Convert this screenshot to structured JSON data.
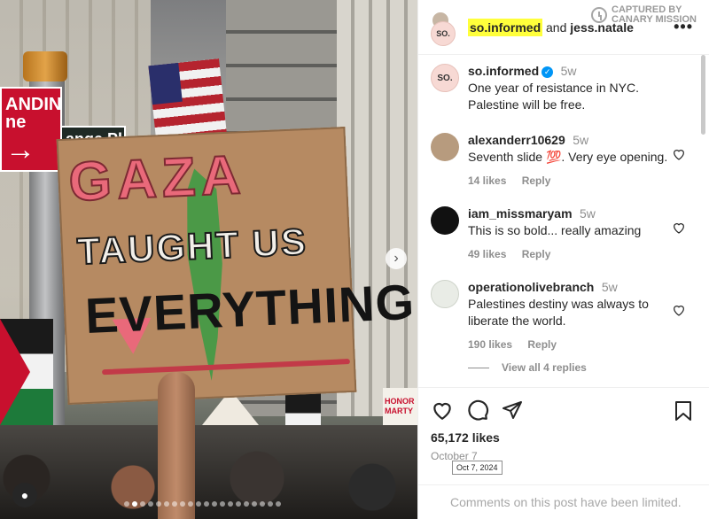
{
  "post": {
    "header": {
      "author": "so.informed",
      "joiner": "and",
      "collaborator": "jess.natale",
      "avatar_text": "SO."
    },
    "watermark": {
      "line1": "CAPTURED BY",
      "line2": "CANARY MISSION"
    },
    "photo": {
      "sign_red_text": "ANDING\nne",
      "sign_street_text": "ange Pl",
      "sign_line1": "GAZA",
      "sign_line2": "TAUGHT US",
      "sign_line3": "EVERYTHING",
      "right_sign_text": "HONOR\nMARTY\n\nOF PALES",
      "carousel_index": 1,
      "carousel_count": 20
    },
    "caption": {
      "username": "so.informed",
      "time": "5w",
      "verified": true,
      "text": "One year of resistance in NYC. Palestine will be free."
    },
    "comments": [
      {
        "username": "alexanderr10629",
        "time": "5w",
        "text": "Seventh slide 💯. Very eye opening.",
        "likes": "14 likes",
        "reply": "Reply",
        "avatar_color": "#b79b7e"
      },
      {
        "username": "iam_missmaryam",
        "time": "5w",
        "text": "This is so bold... really amazing",
        "likes": "49 likes",
        "reply": "Reply",
        "avatar_color": "#111111"
      },
      {
        "username": "operationolivebranch",
        "time": "5w",
        "text": "Palestines destiny was always to liberate the world.",
        "likes": "190 likes",
        "reply": "Reply",
        "avatar_color": "#e9ece6"
      }
    ],
    "view_replies": "View all 4 replies",
    "likes_count": "65,172 likes",
    "date": "October 7",
    "date_tooltip": "Oct 7, 2024",
    "comments_limited": "Comments on this post have been limited."
  }
}
